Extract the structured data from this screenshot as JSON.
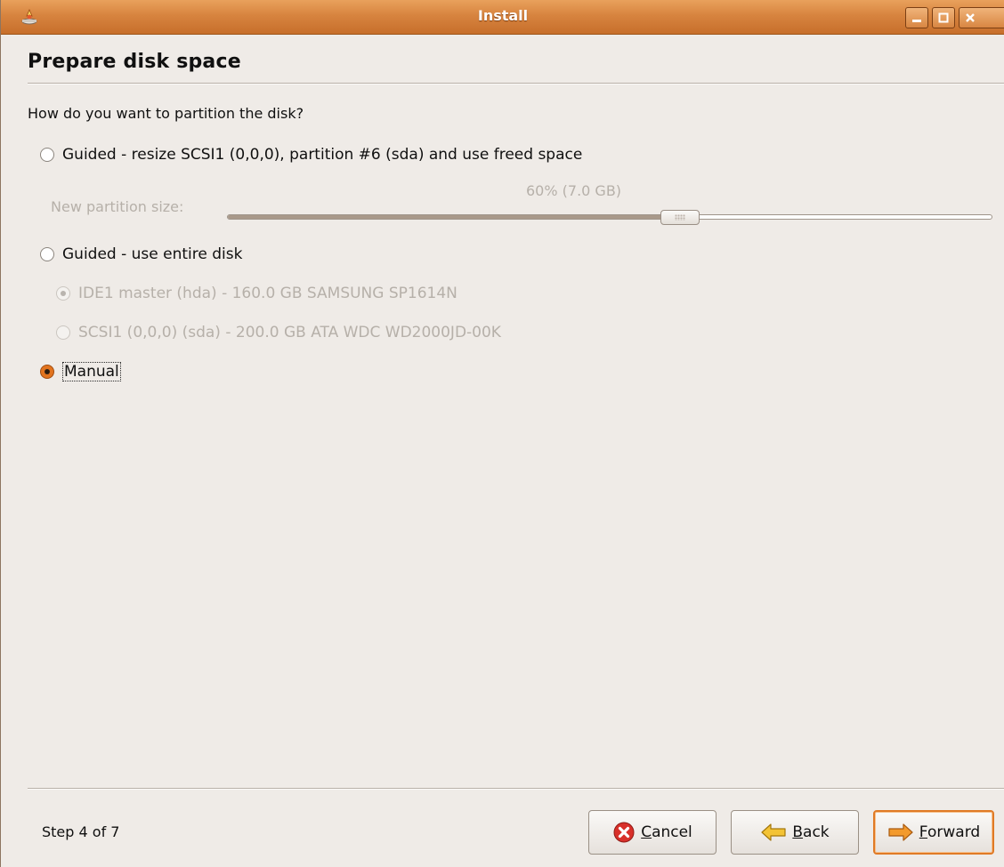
{
  "window": {
    "title": "Install",
    "icons": [
      "installer-icon",
      "minimize-icon",
      "maximize-icon",
      "close-icon"
    ]
  },
  "page": {
    "title": "Prepare disk space",
    "question": "How do you want to partition the disk?"
  },
  "options": {
    "guided_resize": {
      "label": "Guided - resize SCSI1 (0,0,0), partition #6 (sda) and use freed space",
      "selected": false
    },
    "slider": {
      "label": "New partition size:",
      "value_text": "60% (7.0 GB)",
      "percent": 60,
      "enabled": false
    },
    "guided_entire": {
      "label": "Guided - use entire disk",
      "selected": false
    },
    "disks": [
      {
        "label": "IDE1 master (hda) - 160.0 GB SAMSUNG SP1614N",
        "selected": true,
        "enabled": false
      },
      {
        "label": "SCSI1 (0,0,0) (sda) - 200.0 GB ATA WDC WD2000JD-00K",
        "selected": false,
        "enabled": false
      }
    ],
    "manual": {
      "label": "Manual",
      "selected": true
    }
  },
  "footer": {
    "step": "Step 4 of 7",
    "cancel": {
      "mnemonic": "C",
      "rest": "ancel"
    },
    "back": {
      "mnemonic": "B",
      "rest": "ack"
    },
    "forward": {
      "mnemonic": "F",
      "rest": "orward"
    }
  },
  "colors": {
    "accent": "#e07a25",
    "titlebar": "#d7843f",
    "background": "#efebe7"
  }
}
